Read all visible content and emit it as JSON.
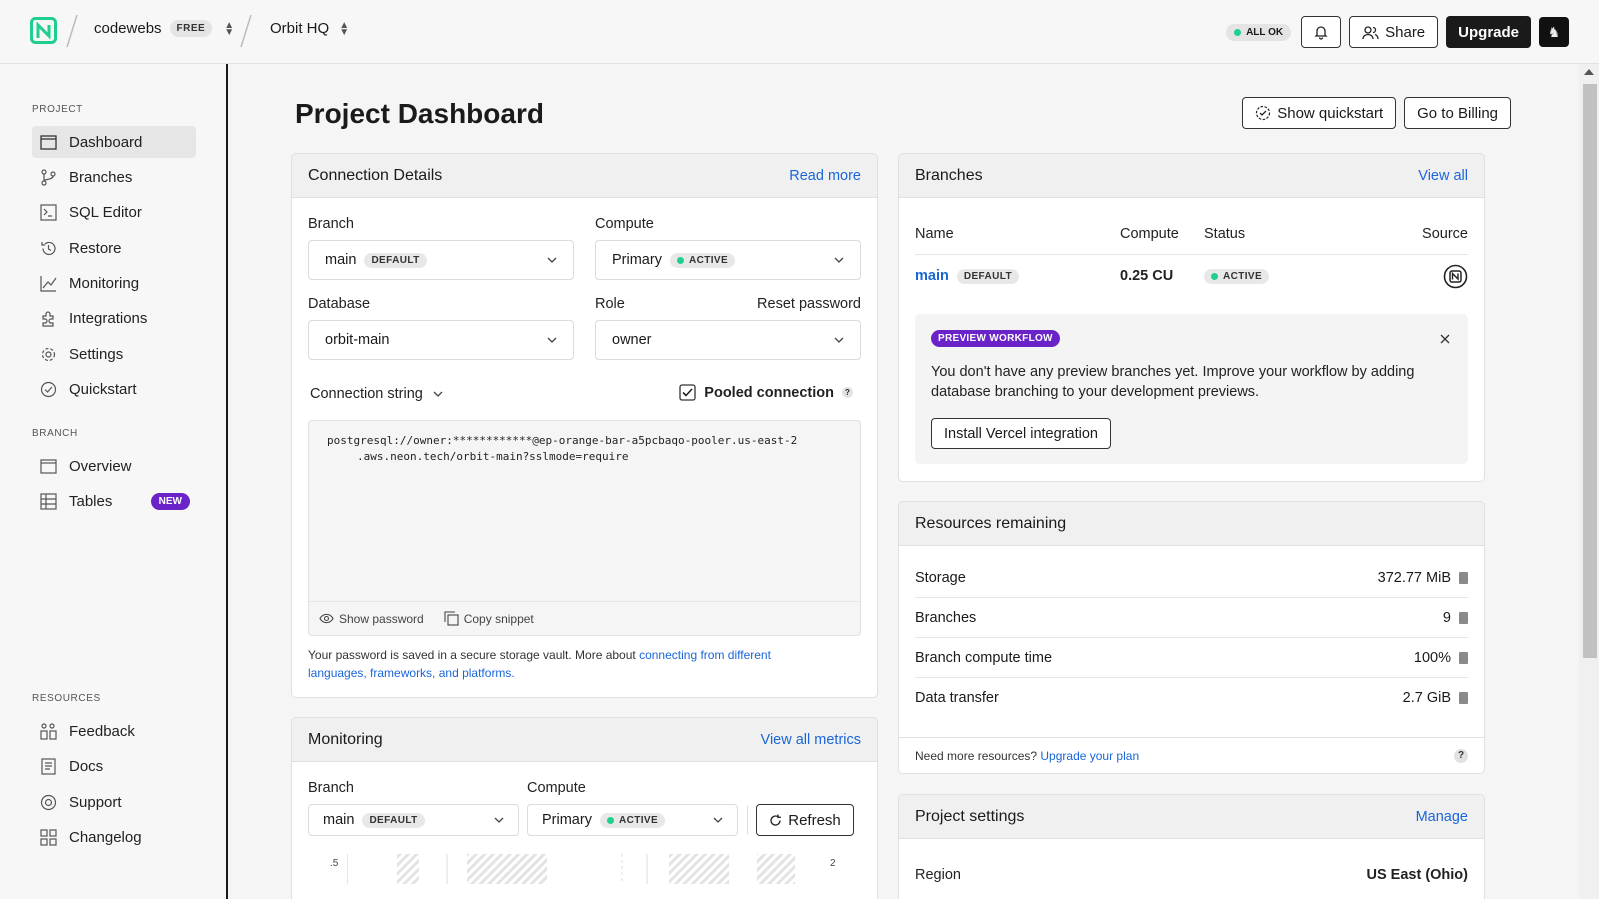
{
  "topbar": {
    "org_name": "codewebs",
    "org_plan": "FREE",
    "project_name": "Orbit HQ",
    "status": "ALL OK",
    "share_label": "Share",
    "upgrade_label": "Upgrade"
  },
  "sidebar": {
    "project_label": "PROJECT",
    "project_items": [
      {
        "label": "Dashboard",
        "icon": "dashboard-icon"
      },
      {
        "label": "Branches",
        "icon": "branch-icon"
      },
      {
        "label": "SQL Editor",
        "icon": "terminal-icon"
      },
      {
        "label": "Restore",
        "icon": "restore-icon"
      },
      {
        "label": "Monitoring",
        "icon": "chart-icon"
      },
      {
        "label": "Integrations",
        "icon": "puzzle-icon"
      },
      {
        "label": "Settings",
        "icon": "gear-icon"
      },
      {
        "label": "Quickstart",
        "icon": "check-circle-icon"
      }
    ],
    "branch_label": "BRANCH",
    "branch_items": [
      {
        "label": "Overview",
        "icon": "overview-icon"
      },
      {
        "label": "Tables",
        "icon": "table-icon",
        "badge": "NEW"
      }
    ],
    "resources_label": "RESOURCES",
    "resource_items": [
      {
        "label": "Feedback",
        "icon": "feedback-icon"
      },
      {
        "label": "Docs",
        "icon": "docs-icon"
      },
      {
        "label": "Support",
        "icon": "support-icon"
      },
      {
        "label": "Changelog",
        "icon": "changelog-icon"
      }
    ]
  },
  "page": {
    "title": "Project Dashboard",
    "quickstart_label": "Show quickstart",
    "billing_label": "Go to Billing"
  },
  "connection": {
    "title": "Connection Details",
    "read_more": "Read more",
    "branch_label": "Branch",
    "branch_value": "main",
    "branch_tag": "DEFAULT",
    "compute_label": "Compute",
    "compute_value": "Primary",
    "compute_tag": "ACTIVE",
    "database_label": "Database",
    "database_value": "orbit-main",
    "role_label": "Role",
    "reset_password": "Reset password",
    "role_value": "owner",
    "conn_string_label": "Connection string",
    "pooled_label": "Pooled connection",
    "code_line1": "postgresql://owner:************@ep-orange-bar-a5pcbaqo-pooler.us-east-2",
    "code_line2": ".aws.neon.tech/orbit-main?sslmode=require",
    "show_password": "Show password",
    "copy_snippet": "Copy snippet",
    "note_text": "Your password is saved in a secure storage vault. More about ",
    "note_link": "connecting from different languages, frameworks, and platforms."
  },
  "monitoring": {
    "title": "Monitoring",
    "view_all": "View all metrics",
    "branch_label": "Branch",
    "branch_value": "main",
    "branch_tag": "DEFAULT",
    "compute_label": "Compute",
    "compute_value": "Primary",
    "compute_tag": "ACTIVE",
    "refresh_label": "Refresh",
    "axis_left": ".5",
    "axis_right": "2"
  },
  "branches": {
    "title": "Branches",
    "view_all": "View all",
    "col_name": "Name",
    "col_compute": "Compute",
    "col_status": "Status",
    "col_source": "Source",
    "row_name": "main",
    "row_tag": "DEFAULT",
    "row_compute": "0.25 CU",
    "row_status": "ACTIVE",
    "preview_pill": "PREVIEW WORKFLOW",
    "preview_text": "You don't have any preview branches yet. Improve your workflow by adding database branching to your development previews.",
    "install_label": "Install Vercel integration"
  },
  "resources": {
    "title": "Resources remaining",
    "rows": [
      {
        "label": "Storage",
        "value": "372.77 MiB"
      },
      {
        "label": "Branches",
        "value": "9"
      },
      {
        "label": "Branch compute time",
        "value": "100%"
      },
      {
        "label": "Data transfer",
        "value": "2.7 GiB"
      }
    ],
    "footer_text": "Need more resources? ",
    "footer_link": "Upgrade your plan"
  },
  "settings": {
    "title": "Project settings",
    "manage": "Manage",
    "region_label": "Region",
    "region_value": "US East (Ohio)"
  },
  "colors": {
    "accent": "#1a66d9",
    "active_dot": "#1fcf8e",
    "purple": "#6a22c9"
  }
}
